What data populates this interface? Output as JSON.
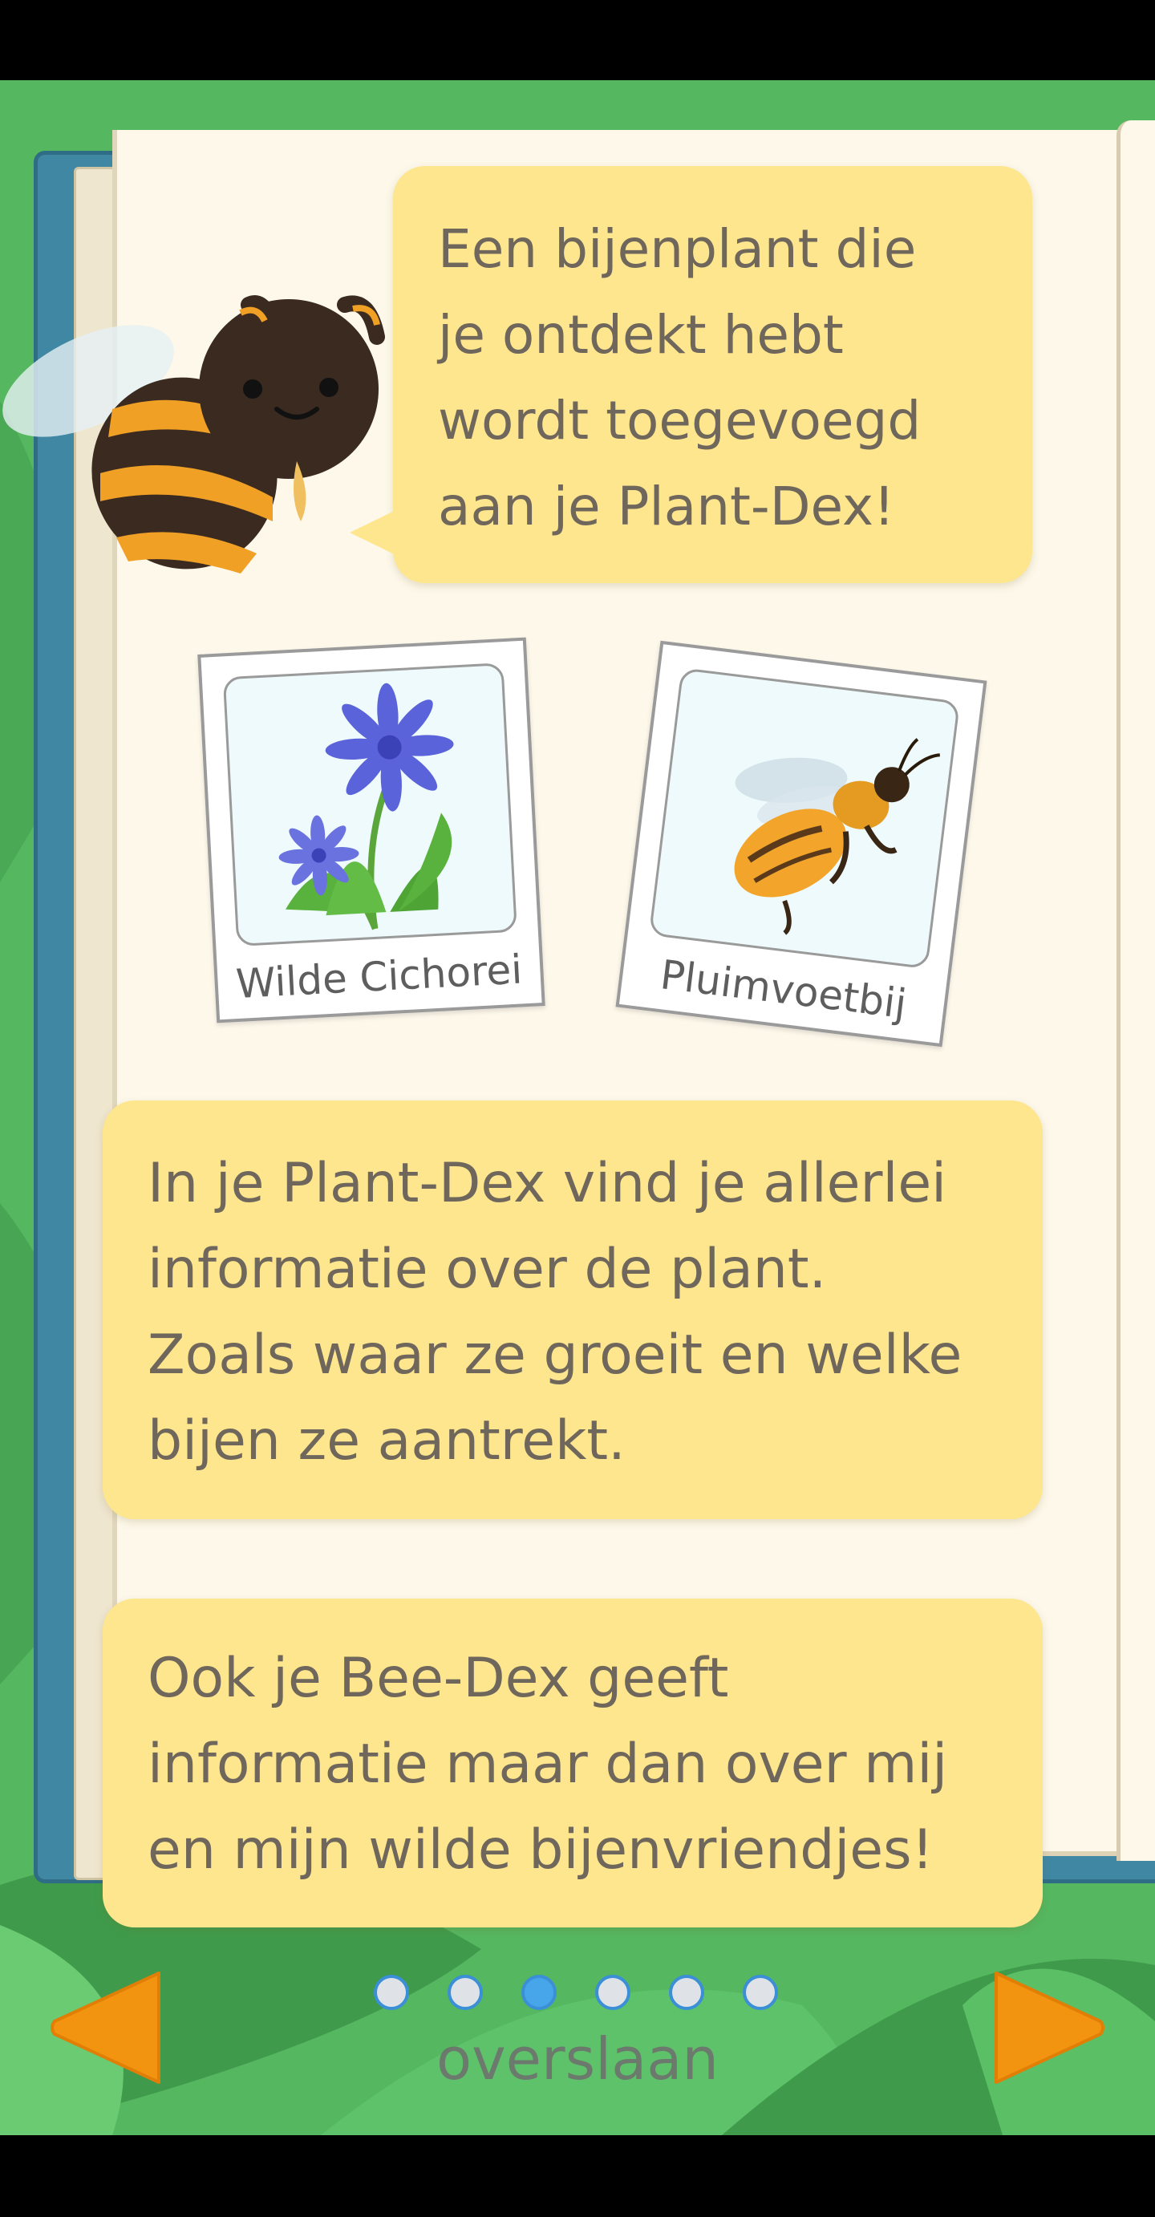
{
  "speech_bubble": {
    "lines": [
      "Een bijenplant die",
      "je ontdekt hebt",
      "wordt toegevoegd",
      "aan je Plant-Dex!"
    ]
  },
  "cards": [
    {
      "caption": "Wilde Cichorei",
      "image": "chicory-flower"
    },
    {
      "caption": "Pluimvoetbij",
      "image": "bee"
    }
  ],
  "info_plant": {
    "lines": [
      "In je Plant-Dex vind je allerlei",
      "informatie over de plant.",
      "Zoals waar ze groeit en welke",
      "bijen ze aantrekt."
    ]
  },
  "info_bee": {
    "lines": [
      "Ook je Bee-Dex geeft",
      "informatie maar dan over mij",
      "en mijn wilde bijenvriendjes!"
    ]
  },
  "pagination": {
    "total": 6,
    "active_index": 2
  },
  "nav": {
    "skip_label": "overslaan",
    "prev_icon": "arrow-left-icon",
    "next_icon": "arrow-right-icon"
  },
  "colors": {
    "bubble": "#fde68d",
    "accent": "#f29512",
    "dot_active": "#47a6ea",
    "background": "#56b861"
  }
}
